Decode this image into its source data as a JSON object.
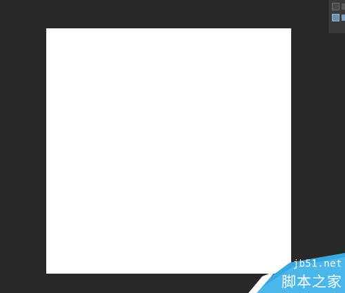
{
  "app": {
    "background_color": "#282828",
    "canvas_color": "#ffffff"
  },
  "panel": {
    "buttons": [
      {
        "icon": "panel-toggle-icon"
      },
      {
        "icon": "panel-toggle-icon-active"
      }
    ]
  },
  "watermark": {
    "url": "jb51.net",
    "name": "脚本之家",
    "accent_color": "#3aa8e0"
  }
}
